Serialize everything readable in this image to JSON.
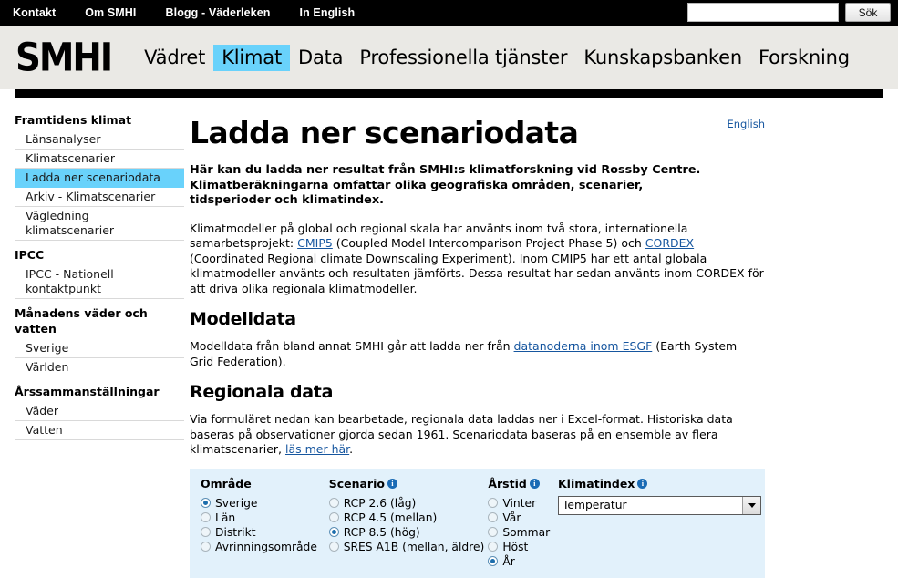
{
  "topbar": {
    "links": [
      {
        "label": "Kontakt"
      },
      {
        "label": "Om SMHI"
      },
      {
        "label": "Blogg - Väderleken"
      },
      {
        "label": "In English"
      }
    ],
    "search": {
      "value": "",
      "placeholder": "",
      "button_label": "Sök"
    }
  },
  "masthead": {
    "logo": "SMHI",
    "nav": [
      {
        "label": "Vädret",
        "active": false
      },
      {
        "label": "Klimat",
        "active": true
      },
      {
        "label": "Data",
        "active": false
      },
      {
        "label": "Professionella tjänster",
        "active": false
      },
      {
        "label": "Kunskapsbanken",
        "active": false
      },
      {
        "label": "Forskning",
        "active": false
      }
    ],
    "active_color": "#69d2fb",
    "background": "#eae9e5"
  },
  "sidebar": {
    "groups": [
      {
        "title": "Framtidens klimat",
        "items": [
          {
            "label": "Länsanalyser",
            "active": false
          },
          {
            "label": "Klimatscenarier",
            "active": false
          },
          {
            "label": "Ladda ner scenariodata",
            "active": true
          },
          {
            "label": "Arkiv - Klimatscenarier",
            "active": false
          },
          {
            "label": "Vägledning klimatscenarier",
            "active": false
          }
        ]
      },
      {
        "title": "IPCC",
        "items": [
          {
            "label": "IPCC - Nationell kontaktpunkt",
            "active": false
          }
        ]
      },
      {
        "title": "Månadens väder och vatten",
        "items": [
          {
            "label": "Sverige",
            "active": false
          },
          {
            "label": "Världen",
            "active": false
          }
        ]
      },
      {
        "title": "Årssammanställningar",
        "items": [
          {
            "label": "Väder",
            "active": false
          },
          {
            "label": "Vatten",
            "active": false
          }
        ]
      }
    ]
  },
  "main": {
    "english_link": "English",
    "title": "Ladda ner scenariodata",
    "lead": "Här kan du ladda ner resultat från SMHI:s klimatforskning vid Rossby Centre. Klimatberäkningarna omfattar olika geografiska områden, scenarier, tidsperioder och klimatindex.",
    "intro_paragraph": {
      "part1": "Klimatmodeller på global och regional skala har använts inom två stora, internationella samarbetsprojekt: ",
      "link1": "CMIP5",
      "part2": " (Coupled Model Intercomparison Project Phase 5) och ",
      "link2": "CORDEX",
      "part3": " (Coordinated Regional climate Downscaling Experiment). Inom CMIP5 har ett antal globala klimatmodeller använts och resultaten jämförts. Dessa resultat har sedan använts inom CORDEX för att driva olika regionala klimatmodeller."
    },
    "modelldata": {
      "heading": "Modelldata",
      "part1": "Modelldata från bland annat SMHI går att ladda ner från ",
      "link": "datanoderna inom ESGF",
      "part2": " (Earth System Grid Federation)."
    },
    "regionala": {
      "heading": "Regionala data",
      "part1": "Via formuläret nedan kan bearbetade, regionala data laddas ner i Excel-format. Historiska data baseras på observationer gjorda sedan 1961. Scenariodata baseras på en ensemble av flera klimatscenarier, ",
      "link": "läs mer här",
      "part2": "."
    },
    "link_color": "#16569f"
  },
  "form": {
    "background": "#e2f1fb",
    "info_icon_label": "i",
    "groups": {
      "omrade": {
        "legend": "Område",
        "has_info": false,
        "options": [
          {
            "label": "Sverige",
            "selected": true
          },
          {
            "label": "Län",
            "selected": false
          },
          {
            "label": "Distrikt",
            "selected": false
          },
          {
            "label": "Avrinningsområde",
            "selected": false
          }
        ]
      },
      "scenario": {
        "legend": "Scenario",
        "has_info": true,
        "options": [
          {
            "label": "RCP 2.6 (låg)",
            "selected": false
          },
          {
            "label": "RCP 4.5 (mellan)",
            "selected": false
          },
          {
            "label": "RCP 8.5 (hög)",
            "selected": true
          },
          {
            "label": "SRES A1B (mellan, äldre)",
            "selected": false
          }
        ]
      },
      "arstid": {
        "legend": "Årstid",
        "has_info": true,
        "options": [
          {
            "label": "Vinter",
            "selected": false
          },
          {
            "label": "Vår",
            "selected": false
          },
          {
            "label": "Sommar",
            "selected": false
          },
          {
            "label": "Höst",
            "selected": false
          },
          {
            "label": "År",
            "selected": true
          }
        ]
      },
      "klimatindex": {
        "legend": "Klimatindex",
        "has_info": true,
        "selected_value": "Temperatur"
      }
    }
  }
}
